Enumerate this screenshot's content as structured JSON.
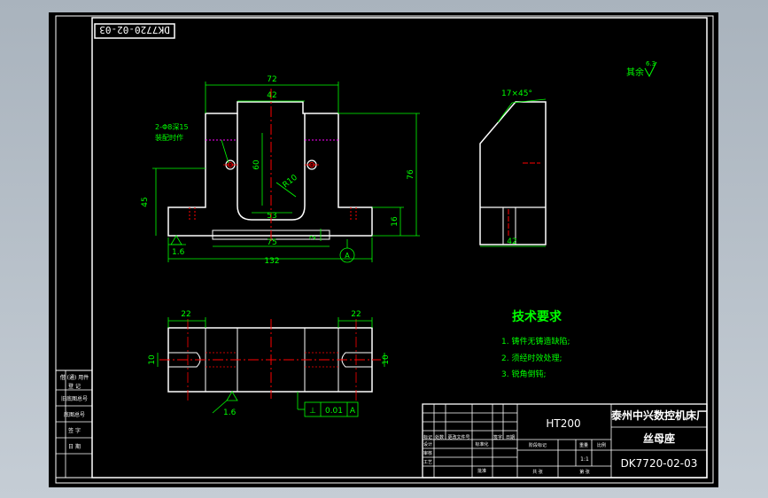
{
  "drawing_number_flipped": "DK7720-02-03",
  "roughness_note": {
    "label": "其余",
    "value": "6.3"
  },
  "dimensions": {
    "front_width_top": "72",
    "front_slot_width": "42",
    "front_bore_note_1": "2-Φ8深15",
    "front_bore_note_2": "装配时作",
    "front_slot_depth": "60",
    "front_radius": "R10",
    "front_height_left": "45",
    "front_inner_width": "53",
    "front_base_inner": "75",
    "front_base_overall": "132",
    "front_step": "2",
    "front_height_right": "76",
    "front_base_height": "16",
    "front_roughness": "1.6",
    "datum_label": "A",
    "side_chamfer": "17×45°",
    "side_width": "42",
    "top_left_22": "22",
    "top_right_22": "22",
    "top_left_10": "10",
    "top_right_10": "10",
    "top_roughness": "1.6",
    "tolerance_symbol": "⊥",
    "tolerance_value": "0.01",
    "tolerance_datum": "A"
  },
  "tech_requirements": {
    "title": "技术要求",
    "items": [
      "1. 铸件无铸造缺陷;",
      "2. 须经时效处理;",
      "3. 锐角倒钝;"
    ]
  },
  "left_strip": [
    "借 (通) 用件",
    "登 记",
    "旧底图总号",
    "底图总号",
    "签 字",
    "日 期"
  ],
  "title_block": {
    "material": "HT200",
    "company": "泰州中兴数控机床厂",
    "part_name": "丝母座",
    "drawing_number": "DK7720-02-03",
    "scale": "1:1",
    "row_labels": [
      "标记",
      "处数",
      "更改文件号",
      "签字",
      "日期"
    ],
    "sign_labels": [
      "设计",
      "审核",
      "工艺",
      "标准化",
      "批准"
    ],
    "small_labels": [
      "阶段标记",
      "重量",
      "比例",
      "共 张",
      "第 张"
    ]
  }
}
